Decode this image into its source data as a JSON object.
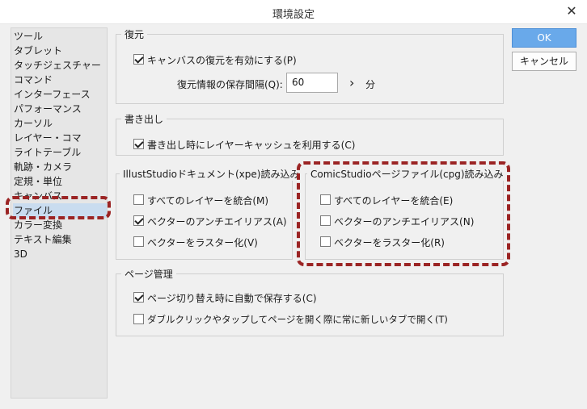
{
  "window": {
    "title": "環境設定",
    "close_glyph": "✕"
  },
  "sidebar": {
    "items": [
      {
        "label": "ツール"
      },
      {
        "label": "タブレット"
      },
      {
        "label": "タッチジェスチャー"
      },
      {
        "label": "コマンド"
      },
      {
        "label": "インターフェース"
      },
      {
        "label": "パフォーマンス"
      },
      {
        "label": "カーソル"
      },
      {
        "label": "レイヤー・コマ"
      },
      {
        "label": "ライトテーブル"
      },
      {
        "label": "軌跡・カメラ"
      },
      {
        "label": "定規・単位"
      },
      {
        "label": "キャンバス"
      },
      {
        "label": "ファイル",
        "selected": true
      },
      {
        "label": "カラー変換"
      },
      {
        "label": "テキスト編集"
      },
      {
        "label": "3D"
      }
    ]
  },
  "buttons": {
    "ok": "OK",
    "cancel": "キャンセル"
  },
  "restore": {
    "legend": "復元",
    "enable_label": "キャンバスの復元を有効にする(P)",
    "enable_checked": true,
    "interval_label": "復元情報の保存間隔(Q):",
    "interval_value": "60",
    "arrow": "›",
    "unit": "分"
  },
  "export": {
    "legend": "書き出し",
    "cache_label": "書き出し時にレイヤーキャッシュを利用する(C)",
    "cache_checked": true
  },
  "illust": {
    "legend": "IllustStudioドキュメント(xpe)読み込み",
    "options": [
      {
        "label": "すべてのレイヤーを統合(M)",
        "checked": false
      },
      {
        "label": "ベクターのアンチエイリアス(A)",
        "checked": true
      },
      {
        "label": "ベクターをラスター化(V)",
        "checked": false
      }
    ]
  },
  "comic": {
    "legend": "ComicStudioページファイル(cpg)読み込み",
    "options": [
      {
        "label": "すべてのレイヤーを統合(E)",
        "checked": false
      },
      {
        "label": "ベクターのアンチエイリアス(N)",
        "checked": false
      },
      {
        "label": "ベクターをラスター化(R)",
        "checked": false
      }
    ]
  },
  "page": {
    "legend": "ページ管理",
    "options": [
      {
        "label": "ページ切り替え時に自動で保存する(C)",
        "checked": true
      },
      {
        "label": "ダブルクリックやタップしてページを開く際に常に新しいタブで開く(T)",
        "checked": false
      }
    ]
  },
  "colors": {
    "highlight": "#9b2424",
    "selected_bg": "#c9dcef",
    "ok_blue": "#69a9ea"
  }
}
